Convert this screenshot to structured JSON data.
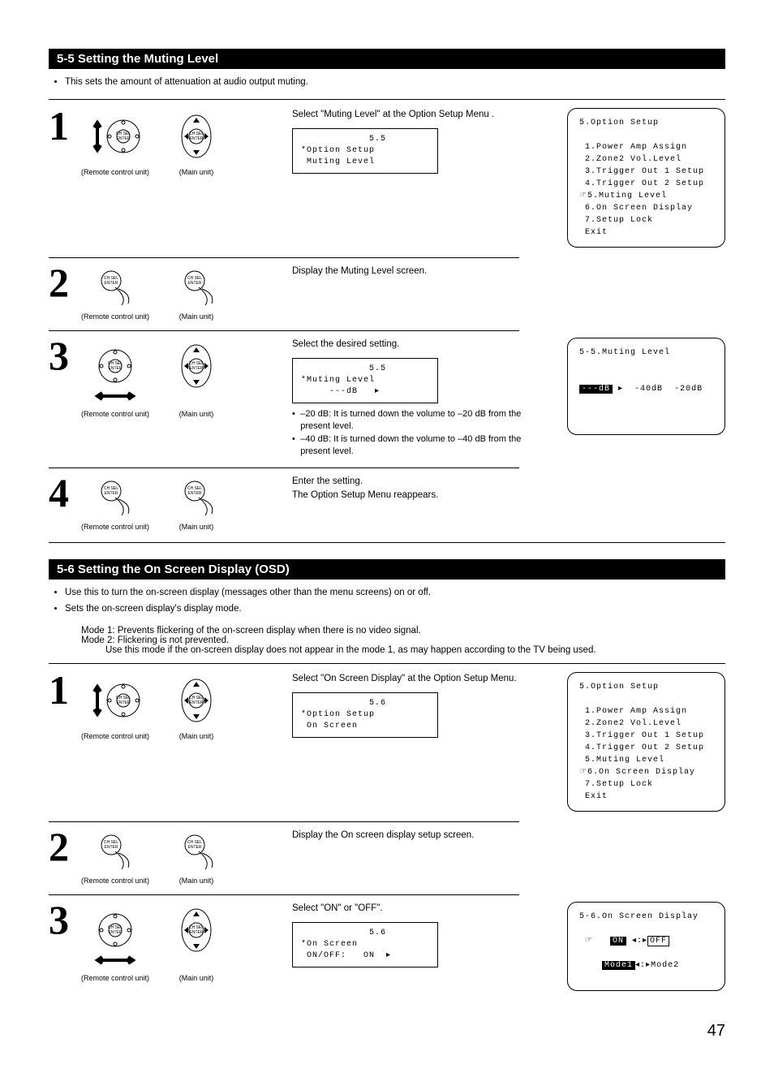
{
  "section55": {
    "title": "5-5 Setting the Muting Level",
    "intro": "This sets the amount of attenuation at audio output muting.",
    "steps": [
      {
        "num": "1",
        "instruction": "Select \"Muting Level\" at the Option Setup Menu .",
        "lcd_top": "            5.5",
        "lcd_l1": "*Option Setup",
        "lcd_l2": " Muting Level",
        "bullets": []
      },
      {
        "num": "2",
        "instruction": "Display the Muting Level screen.",
        "lcd_top": "",
        "lcd_l1": "",
        "lcd_l2": "",
        "bullets": []
      },
      {
        "num": "3",
        "instruction": "Select the desired setting.",
        "lcd_top": "            5.5",
        "lcd_l1": "*Muting Level",
        "lcd_l2": "     ---dB   ▸",
        "bullets": [
          "–20 dB: It is turned down the volume to –20 dB from the present level.",
          "–40 dB: It is turned down the volume to –40 dB from the present level."
        ]
      },
      {
        "num": "4",
        "instruction": "Enter the setting.",
        "instruction2": "The Option Setup Menu reappears.",
        "lcd_top": "",
        "lcd_l1": "",
        "lcd_l2": "",
        "bullets": []
      }
    ],
    "osd_menu": {
      "title": "5.Option Setup",
      "items": [
        "1.Power Amp Assign",
        "2.Zone2 Vol.Level",
        "3.Trigger Out 1 Setup",
        "4.Trigger Out 2 Setup",
        "5.Muting Level",
        "6.On Screen Display",
        "7.Setup Lock",
        "Exit"
      ],
      "selected_index": 4
    },
    "osd_muting": {
      "title": "5-5.Muting Level",
      "current": "---dB",
      "opt1": "-40dB",
      "opt2": "-20dB"
    }
  },
  "section56": {
    "title": "5-6 Setting the On Screen Display (OSD)",
    "intro1": "Use this to turn the on-screen display (messages other than the menu screens) on or off.",
    "intro2": "Sets the on-screen display's display mode.",
    "mode1": "Mode 1:  Prevents flickering of the on-screen display when there is no video signal.",
    "mode2": "Mode 2:  Flickering is not prevented.",
    "mode2b": "Use this mode if the on-screen display does not appear in the mode 1, as may happen according to the TV being used.",
    "steps": [
      {
        "num": "1",
        "instruction": "Select \"On Screen Display\" at the Option Setup Menu.",
        "lcd_top": "            5.6",
        "lcd_l1": "*Option Setup",
        "lcd_l2": " On Screen"
      },
      {
        "num": "2",
        "instruction": "Display the On screen display setup screen.",
        "lcd_top": "",
        "lcd_l1": "",
        "lcd_l2": ""
      },
      {
        "num": "3",
        "instruction": "Select \"ON\" or \"OFF\".",
        "lcd_top": "            5.6",
        "lcd_l1": "*On Screen",
        "lcd_l2": " ON/OFF:   ON  ▸"
      }
    ],
    "osd_menu": {
      "title": "5.Option Setup",
      "items": [
        "1.Power Amp Assign",
        "2.Zone2 Vol.Level",
        "3.Trigger Out 1 Setup",
        "4.Trigger Out 2 Setup",
        "5.Muting Level",
        "6.On Screen Display",
        "7.Setup Lock",
        "Exit"
      ],
      "selected_index": 5
    },
    "osd_onscreen": {
      "title": "5-6.On Screen Display",
      "on": "ON",
      "off": "OFF",
      "mode1": "Mode1",
      "mode2": "Mode2"
    }
  },
  "captions": {
    "remote": "(Remote control unit)",
    "main": "(Main unit)"
  },
  "pageNum": "47"
}
